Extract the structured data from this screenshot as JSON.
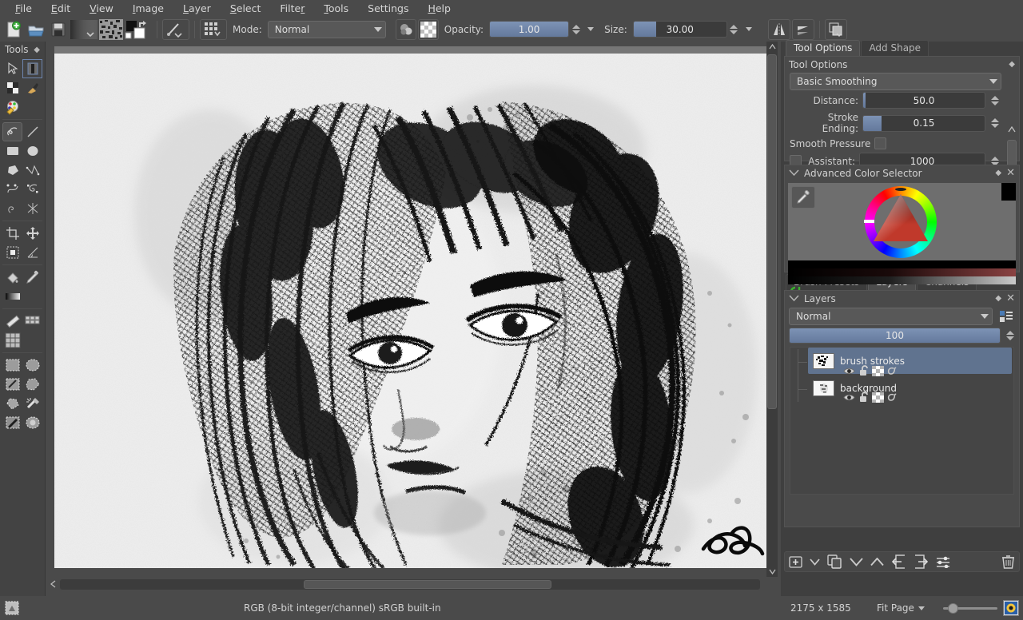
{
  "app": {
    "name": "Krita",
    "accent_selection": "#60738f",
    "accent_slider": "#6f86ab",
    "chrome_bg": "#4a4a4a",
    "panel_bg": "#434343"
  },
  "menubar": {
    "items": [
      {
        "label": "File",
        "accel": "F"
      },
      {
        "label": "Edit",
        "accel": "E"
      },
      {
        "label": "View",
        "accel": "V"
      },
      {
        "label": "Image",
        "accel": "I"
      },
      {
        "label": "Layer",
        "accel": "L"
      },
      {
        "label": "Select",
        "accel": "S"
      },
      {
        "label": "Filter",
        "accel": "r"
      },
      {
        "label": "Tools",
        "accel": "T"
      },
      {
        "label": "Settings",
        "accel": "g"
      },
      {
        "label": "Help",
        "accel": "H"
      }
    ]
  },
  "toolbar": {
    "buttons": [
      {
        "name": "new-document-button",
        "icon": "new-file-icon"
      },
      {
        "name": "open-document-button",
        "icon": "open-folder-icon"
      },
      {
        "name": "save-document-button",
        "icon": "floppy-save-icon"
      },
      {
        "name": "gradient-preset-button",
        "icon": "gradient-swatch-icon"
      },
      {
        "name": "pattern-preset-button",
        "icon": "pattern-swatch-icon"
      },
      {
        "name": "fg-bg-color-button",
        "icon": "foreground-background-color-icon"
      },
      {
        "name": "brush-preset-button",
        "icon": "brush-preset-icon"
      },
      {
        "name": "brush-editor-button",
        "icon": "brush-editor-icon"
      }
    ],
    "mode_label": "Mode:",
    "blend_mode": "Normal",
    "opacity_label": "Opacity:",
    "opacity_value": "1.00",
    "opacity_fill_pct": 100,
    "size_label": "Size:",
    "size_value": "30.00",
    "size_fill_pct": 24,
    "right_buttons": [
      {
        "name": "mirror-horizontal-button",
        "icon": "mirror-horizontal-icon"
      },
      {
        "name": "mirror-vertical-button",
        "icon": "mirror-vertical-icon"
      },
      {
        "name": "workspace-switcher-button",
        "icon": "workspace-icon"
      }
    ],
    "eraser_button": {
      "name": "eraser-toggle-button",
      "icon": "eraser-icon"
    },
    "alpha_button": {
      "name": "preserve-alpha-button",
      "icon": "checkerboard-alpha-icon"
    }
  },
  "toolbox": {
    "title": "Tools",
    "tools": [
      {
        "name": "tool-shape-select",
        "icon": "arrow-cursor-icon",
        "active": false
      },
      {
        "name": "tool-text",
        "icon": "text-tool-icon",
        "active": false,
        "boxed": true
      },
      {
        "name": "tool-gradient-edit",
        "icon": "gradient-edit-icon",
        "active": false
      },
      {
        "name": "tool-calligraphy",
        "icon": "calligraphy-pen-icon",
        "active": false
      },
      {
        "name": "tool-color-sampler-fill",
        "icon": "fill-palette-icon",
        "active": false
      },
      {
        "name": "tool-freehand-brush",
        "icon": "freehand-squiggle-icon",
        "active": true
      },
      {
        "name": "tool-line",
        "icon": "line-icon",
        "active": false
      },
      {
        "name": "tool-rectangle",
        "icon": "rectangle-icon",
        "active": false
      },
      {
        "name": "tool-ellipse",
        "icon": "ellipse-icon",
        "active": false
      },
      {
        "name": "tool-polygon",
        "icon": "polygon-icon",
        "active": false
      },
      {
        "name": "tool-polyline",
        "icon": "polyline-icon",
        "active": false
      },
      {
        "name": "tool-bezier-curve",
        "icon": "bezier-curve-icon",
        "active": false
      },
      {
        "name": "tool-freehand-path",
        "icon": "freehand-path-icon",
        "active": false
      },
      {
        "name": "tool-dynamic-brush",
        "icon": "dynamic-brush-icon",
        "active": false
      },
      {
        "name": "tool-multibrush",
        "icon": "multibrush-icon",
        "active": false
      },
      {
        "name": "tool-crop",
        "icon": "crop-icon",
        "active": false
      },
      {
        "name": "tool-move",
        "icon": "move-arrows-icon",
        "active": false
      },
      {
        "name": "tool-transform",
        "icon": "transform-icon",
        "active": false
      },
      {
        "name": "tool-measure",
        "icon": "measure-angle-icon",
        "active": false
      },
      {
        "name": "tool-fill",
        "icon": "paint-bucket-icon",
        "active": false
      },
      {
        "name": "tool-color-picker",
        "icon": "eyedropper-icon",
        "active": false
      },
      {
        "name": "tool-gradient",
        "icon": "gradient-bar-icon",
        "active": false
      },
      {
        "name": "tool-assistant-ruler",
        "icon": "ruler-icon",
        "active": false
      },
      {
        "name": "tool-assistant-edit",
        "icon": "assistant-grid-icon",
        "active": false
      },
      {
        "name": "tool-grid",
        "icon": "grid-icon",
        "active": false
      },
      {
        "name": "tool-select-rectangle",
        "icon": "select-rectangle-icon",
        "active": false
      },
      {
        "name": "tool-select-ellipse",
        "icon": "select-ellipse-icon",
        "active": false
      },
      {
        "name": "tool-select-freehand",
        "icon": "select-freehand-icon",
        "active": false
      },
      {
        "name": "tool-select-polygonal",
        "icon": "select-polygon-icon",
        "active": false
      },
      {
        "name": "tool-select-contiguous",
        "icon": "select-contiguous-icon",
        "active": false
      },
      {
        "name": "tool-select-magnetic",
        "icon": "select-magic-wand-icon",
        "active": false
      },
      {
        "name": "tool-select-path",
        "icon": "select-path-icon",
        "active": false
      },
      {
        "name": "tool-select-similar",
        "icon": "select-similar-icon",
        "active": false
      }
    ]
  },
  "tool_options": {
    "tabs": [
      {
        "label": "Tool Options",
        "active": true,
        "name": "tab-tool-options"
      },
      {
        "label": "Add Shape",
        "active": false,
        "name": "tab-add-shape"
      }
    ],
    "title": "Tool Options",
    "smoothing_mode": "Basic Smoothing",
    "fields": [
      {
        "label": "Distance:",
        "value": "50.0",
        "fill_pct": 2
      },
      {
        "label": "Stroke Ending:",
        "value": "0.15",
        "fill_pct": 15
      }
    ],
    "smooth_pressure_label": "Smooth Pressure",
    "smooth_pressure_checked": false,
    "assistant_label": "Assistant:",
    "assistant_checked": false,
    "assistant_value": "1000"
  },
  "color_selector": {
    "title": "Advanced Color Selector",
    "eyedropper_icon": "eyedropper-icon",
    "reset_icon": "reset-circular-arrow-icon",
    "foreground_color": "#000000",
    "wheel_selected_hue": "#d9433a",
    "triangle_color": "#bb3b32"
  },
  "layers": {
    "tabs": [
      {
        "label": "Brush Presets",
        "active": false,
        "name": "tab-brush-presets"
      },
      {
        "label": "Layers",
        "active": true,
        "name": "tab-layers"
      },
      {
        "label": "Channels",
        "active": false,
        "name": "tab-channels"
      }
    ],
    "title": "Layers",
    "blend_mode": "Normal",
    "opacity_value": "100",
    "opacity_fill_pct": 100,
    "items": [
      {
        "name": "brush strokes",
        "selected": true,
        "props": [
          "visibility-eye-icon",
          "lock-open-icon",
          "alpha-checkerboard-icon",
          "alpha-inherit-icon"
        ]
      },
      {
        "name": "background",
        "selected": false,
        "props": [
          "visibility-eye-icon",
          "lock-open-icon",
          "alpha-checkerboard-icon",
          "alpha-inherit-icon"
        ]
      }
    ],
    "tool_buttons": [
      {
        "name": "add-layer-button",
        "icon": "add-plus-icon"
      },
      {
        "name": "add-layer-dropdown",
        "icon": "chevron-down-icon"
      },
      {
        "name": "duplicate-layer-button",
        "icon": "duplicate-layers-icon"
      },
      {
        "name": "move-layer-down-button",
        "icon": "chevron-down-icon"
      },
      {
        "name": "move-layer-up-button",
        "icon": "chevron-up-icon"
      },
      {
        "name": "move-layer-out-button",
        "icon": "arrow-out-of-group-icon"
      },
      {
        "name": "move-layer-into-button",
        "icon": "arrow-into-group-icon"
      },
      {
        "name": "layer-properties-button",
        "icon": "layer-properties-sliders-icon"
      },
      {
        "name": "delete-layer-button",
        "icon": "trash-can-icon"
      }
    ]
  },
  "statusbar": {
    "selection_icon": "selection-mask-icon",
    "color_info": "RGB (8-bit integer/channel)  sRGB built-in",
    "image_dimensions": "2175 x 1585",
    "zoom_mode": "Fit Page",
    "zoom_slider_pct": 12,
    "preview_icon": "canvas-preview-icon"
  }
}
